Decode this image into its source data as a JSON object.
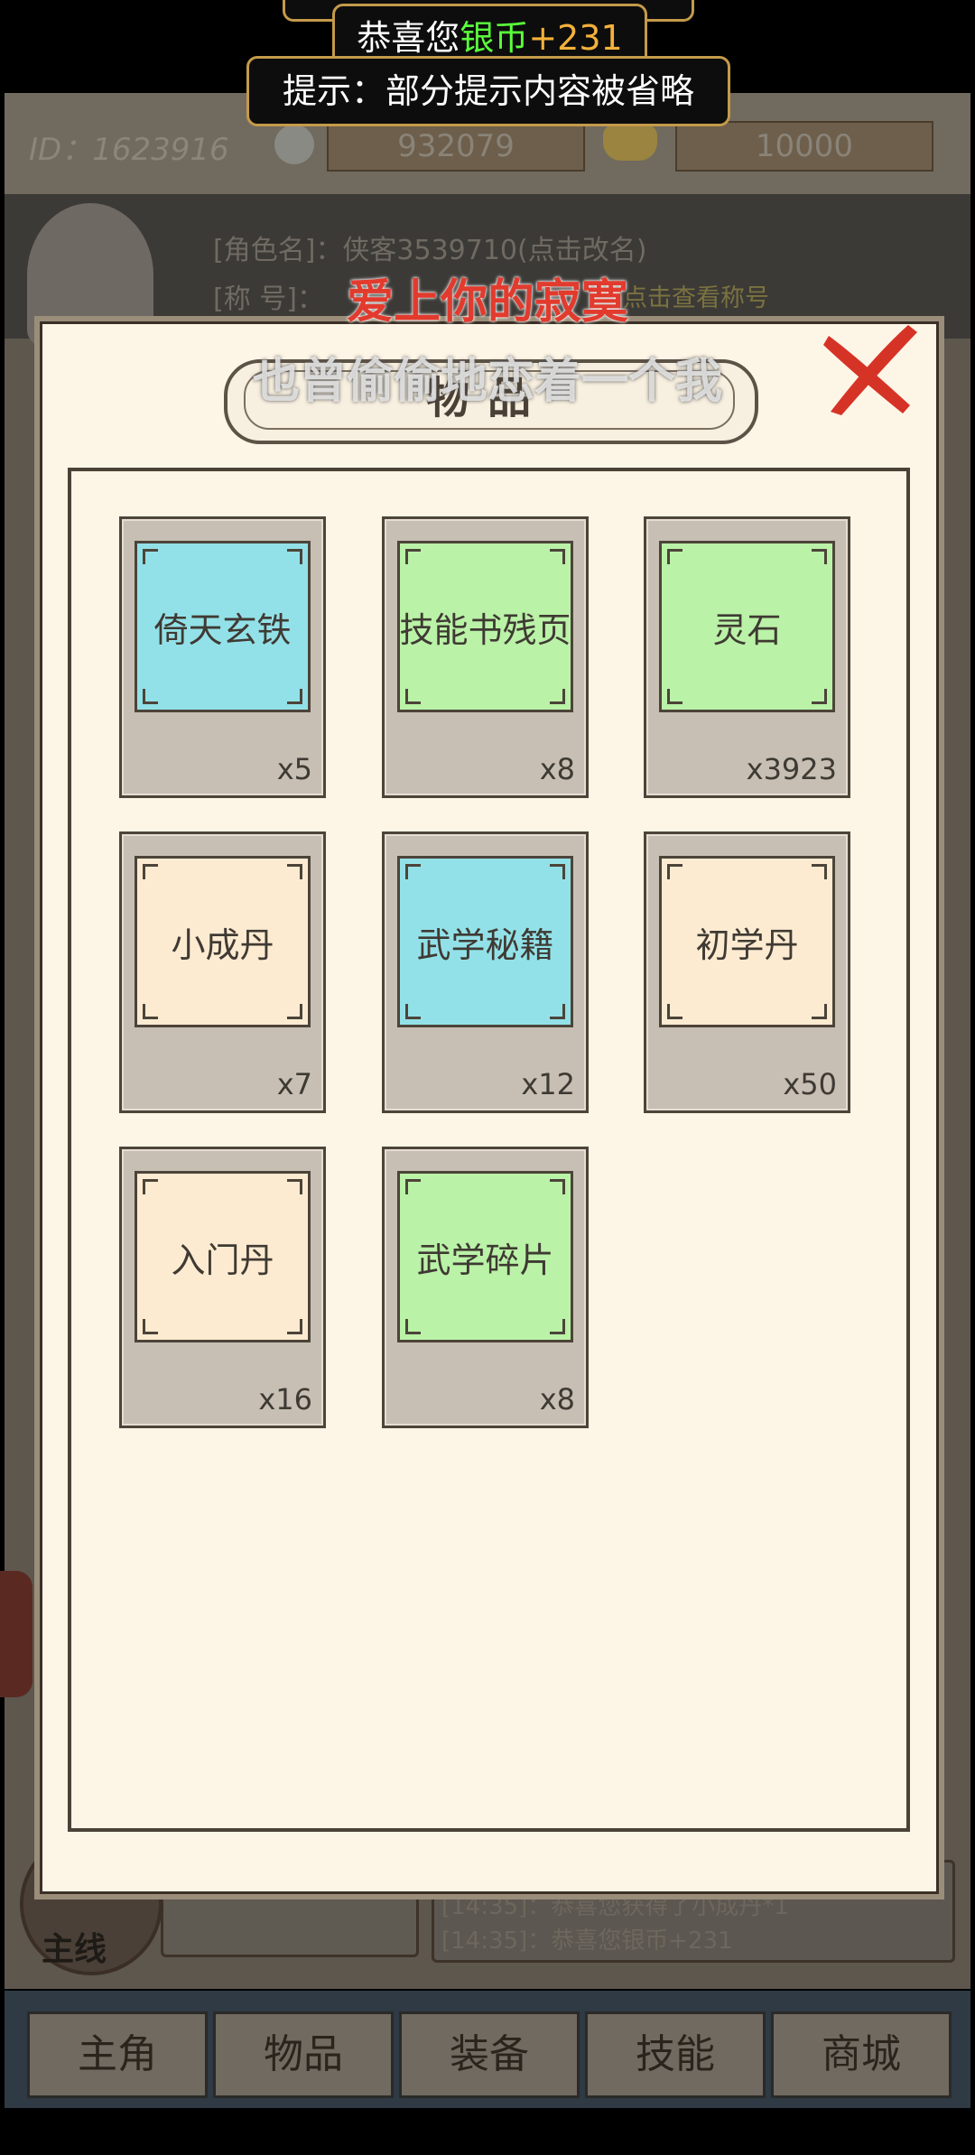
{
  "toasts": {
    "top_partial": "",
    "reward_prefix": "恭喜您",
    "reward_currency": "银币",
    "reward_amount": "+231",
    "notice": "提示：部分提示内容被省略"
  },
  "stats": {
    "id_label": "ID：1623916",
    "silver": "932079",
    "gold": "10000"
  },
  "profile": {
    "name_line": "[角色名]：侠客3539710(点击改名)",
    "title_line": "[称  号]：",
    "title_hint": "点击查看称号"
  },
  "lyrics": {
    "line1": "爱上你的寂寞",
    "line2": "也曾偷偷地恋着一个我"
  },
  "modal": {
    "title": "物品",
    "close_icon": "close-x-icon"
  },
  "items": [
    {
      "name": "倚天玄铁",
      "count": "x5",
      "color": "#93e1e8"
    },
    {
      "name": "技能书残页",
      "count": "x8",
      "color": "#baf2a7"
    },
    {
      "name": "灵石",
      "count": "x3923",
      "color": "#baf2a7"
    },
    {
      "name": "小成丹",
      "count": "x7",
      "color": "#fdebd1"
    },
    {
      "name": "武学秘籍",
      "count": "x12",
      "color": "#93e1e8"
    },
    {
      "name": "初学丹",
      "count": "x50",
      "color": "#fdebd1"
    },
    {
      "name": "入门丹",
      "count": "x16",
      "color": "#fdebd1"
    },
    {
      "name": "武学碎片",
      "count": "x8",
      "color": "#baf2a7"
    }
  ],
  "bottom": {
    "main_quest_label": "主线",
    "chat": [
      "[14:35]：恭喜您获得了小成丹*1",
      "[14:35]：恭喜您银币+231"
    ]
  },
  "nav": [
    "主角",
    "物品",
    "装备",
    "技能",
    "商城"
  ],
  "colors": {
    "accent_red": "#e23b2e",
    "silver_green": "#5aff3c",
    "amount_orange": "#f4b13a",
    "modal_bg": "#fdf5e6"
  }
}
